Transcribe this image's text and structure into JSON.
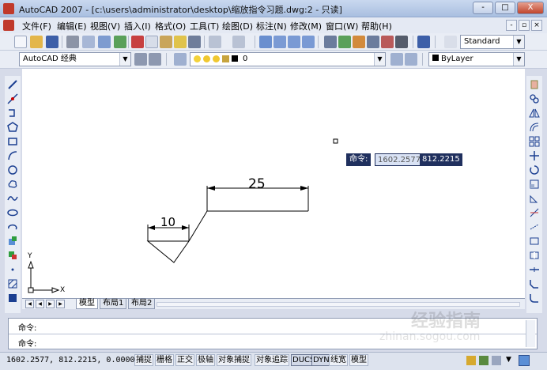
{
  "window": {
    "title": "AutoCAD 2007 - [c:\\users\\administrator\\desktop\\缩放指令习题.dwg:2 - 只读]",
    "controls": [
      "-",
      "□",
      "X"
    ]
  },
  "menu": {
    "items": [
      "文件(F)",
      "编辑(E)",
      "视图(V)",
      "插入(I)",
      "格式(O)",
      "工具(T)",
      "绘图(D)",
      "标注(N)",
      "修改(M)",
      "窗口(W)",
      "帮助(H)"
    ],
    "mdi_controls": [
      "-",
      "▫",
      "×"
    ]
  },
  "toolbar": {
    "text_style": "Standard",
    "workspace": "AutoCAD 经典",
    "layer": "0",
    "color": "ByLayer"
  },
  "drawing": {
    "dimension_top": "25",
    "dimension_left": "10",
    "ucs_y": "Y",
    "ucs_x": "X"
  },
  "dynamic_input": {
    "prompt": "命令:",
    "x_value": "1602.2577",
    "y_value": "812.2215"
  },
  "tabs": {
    "items": [
      "模型",
      "布局1",
      "布局2"
    ],
    "active": "模型"
  },
  "command": {
    "line1": "命令:",
    "line2": "命令:"
  },
  "status": {
    "coords": "1602.2577, 812.2215, 0.0000",
    "buttons": [
      "捕捉",
      "栅格",
      "正交",
      "极轴",
      "对象捕捉",
      "对象追踪",
      "DUCS",
      "DYN",
      "线宽",
      "模型"
    ]
  },
  "watermark": {
    "brand": "经验指南",
    "url": "zhinan.sogou.com"
  },
  "colors": {
    "titlebar": "#b7cae8",
    "dyn_bg": "#20305e",
    "canvas": "#ffffff",
    "toolbar_bg": "#e9edf5"
  }
}
